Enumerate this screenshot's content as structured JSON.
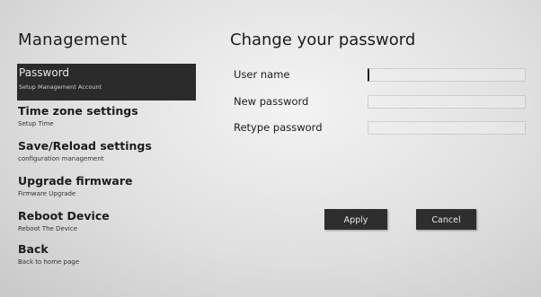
{
  "sidebar": {
    "title": "Management",
    "items": [
      {
        "label": "Password",
        "sub": "Setup Management Account",
        "active": true
      },
      {
        "label": "Time zone settings",
        "sub": "Setup Time"
      },
      {
        "label": "Save/Reload settings",
        "sub": "configuration management"
      },
      {
        "label": "Upgrade firmware",
        "sub": "Firmware Upgrade"
      },
      {
        "label": "Reboot Device",
        "sub": "Reboot The Device"
      },
      {
        "label": "Back",
        "sub": "Back to home page"
      }
    ]
  },
  "main": {
    "title": "Change your password",
    "fields": {
      "username": {
        "label": "User name",
        "value": ""
      },
      "new_password": {
        "label": "New password",
        "value": ""
      },
      "retype_password": {
        "label": "Retype password",
        "value": ""
      }
    },
    "buttons": {
      "apply": "Apply",
      "cancel": "Cancel"
    }
  }
}
